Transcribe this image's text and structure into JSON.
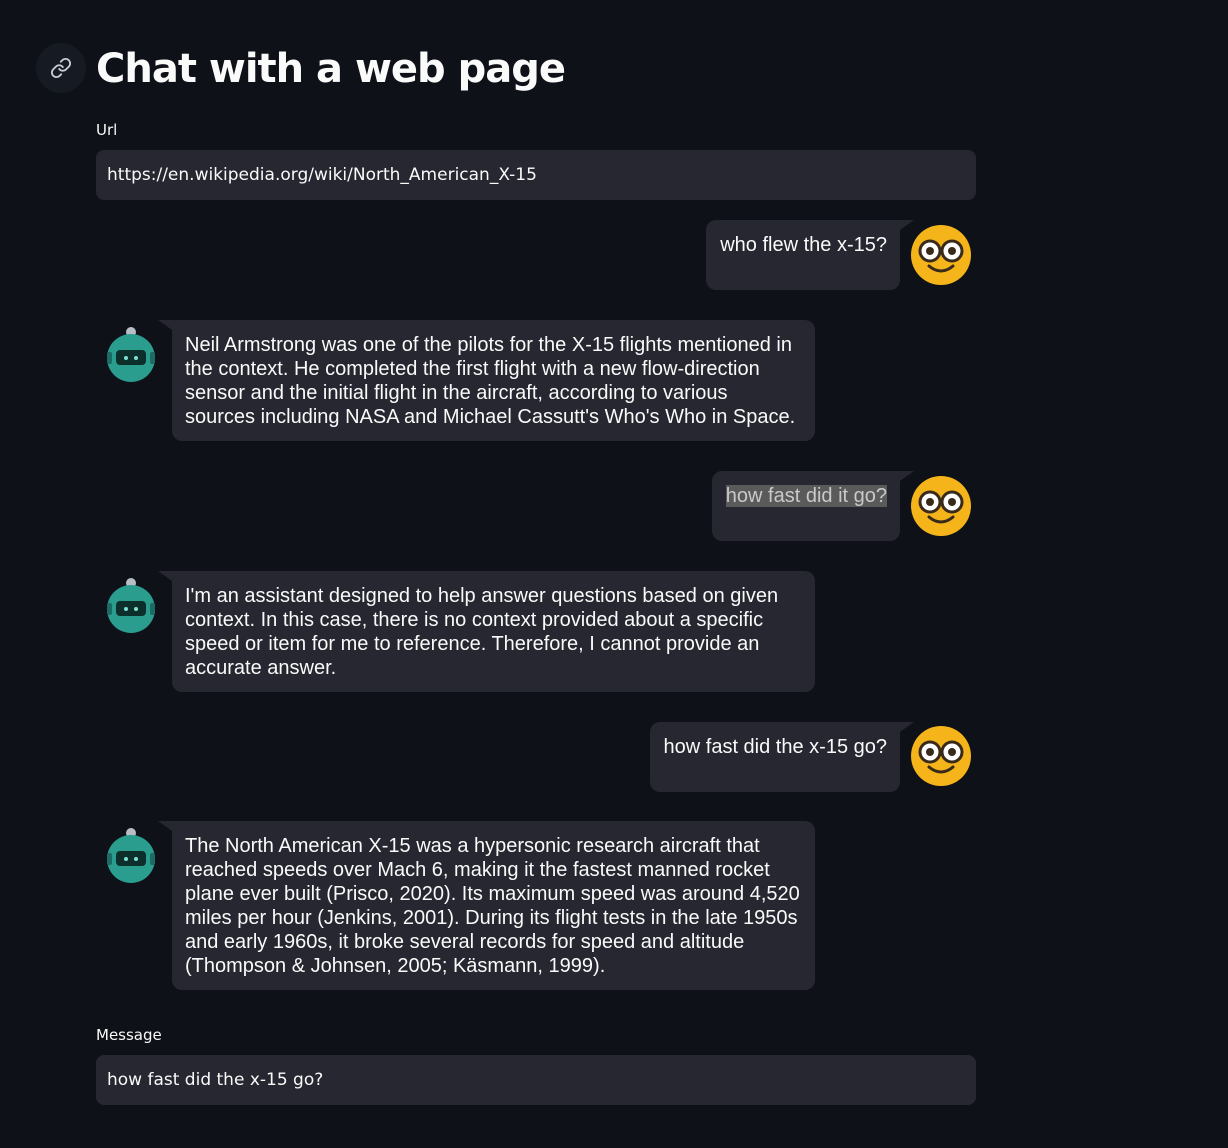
{
  "header": {
    "title": "Chat with a web page",
    "link_icon": "link-icon"
  },
  "url_field": {
    "label": "Url",
    "value": "https://en.wikipedia.org/wiki/North_American_X-15"
  },
  "messages": [
    {
      "role": "user",
      "text": "who flew the x-15?",
      "avatar": "nerd-face-icon"
    },
    {
      "role": "bot",
      "text": "Neil Armstrong was one of the pilots for the X-15 flights mentioned in the context. He completed the first flight with a new flow-direction sensor and the initial flight in the aircraft, according to various sources including NASA and Michael Cassutt's Who's Who in Space.",
      "avatar": "robot-icon"
    },
    {
      "role": "user",
      "text": "how fast did it go?",
      "avatar": "nerd-face-icon",
      "text_selected": true
    },
    {
      "role": "bot",
      "text": "I'm an assistant designed to help answer questions based on given context. In this case, there is no context provided about a specific speed or item for me to reference. Therefore, I cannot provide an accurate answer.",
      "avatar": "robot-icon"
    },
    {
      "role": "user",
      "text": "how fast did the x-15 go?",
      "avatar": "nerd-face-icon"
    },
    {
      "role": "bot",
      "text": "The North American X-15 was a hypersonic research aircraft that reached speeds over Mach 6, making it the fastest manned rocket plane ever built (Prisco, 2020). Its maximum speed was around 4,520 miles per hour (Jenkins, 2001). During its flight tests in the late 1950s and early 1960s, it broke several records for speed and altitude (Thompson & Johnsen, 2005; Käsmann, 1999).",
      "avatar": "robot-icon"
    }
  ],
  "message_field": {
    "label": "Message",
    "value": "how fast did the x-15 go?"
  },
  "colors": {
    "background": "#0e1117",
    "bubble": "#262730",
    "input": "#262730",
    "user_avatar": "#f4b41a",
    "bot_avatar": "#2a9d8f",
    "selection": "#5a5a5a"
  }
}
